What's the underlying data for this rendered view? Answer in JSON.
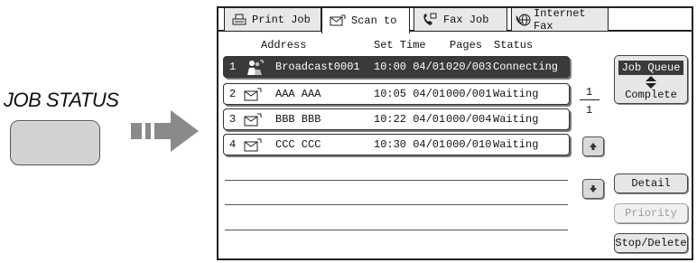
{
  "key_label": "JOB STATUS",
  "tabs": [
    {
      "label": "Print Job",
      "icon": "printer-icon"
    },
    {
      "label": "Scan to",
      "icon": "scan-envelope-icon"
    },
    {
      "label": "Fax Job",
      "icon": "fax-phone-icon"
    },
    {
      "label": "Internet Fax",
      "icon": "globe-phone-icon"
    }
  ],
  "active_tab": "Scan to",
  "columns": {
    "address": "Address",
    "set_time": "Set Time",
    "pages": "Pages",
    "status": "Status"
  },
  "jobs": [
    {
      "num": "1",
      "icon": "broadcast-icon",
      "address": "Broadcast0001",
      "time": "10:00 04/01",
      "pages": "020/003",
      "status": "Connecting",
      "selected": true
    },
    {
      "num": "2",
      "icon": "envelope-icon",
      "address": "AAA AAA",
      "time": "10:05 04/01",
      "pages": "000/001",
      "status": "Waiting",
      "selected": false
    },
    {
      "num": "3",
      "icon": "envelope-icon",
      "address": "BBB BBB",
      "time": "10:22 04/01",
      "pages": "000/004",
      "status": "Waiting",
      "selected": false
    },
    {
      "num": "4",
      "icon": "envelope-icon",
      "address": "CCC CCC",
      "time": "10:30 04/01",
      "pages": "000/010",
      "status": "Waiting",
      "selected": false
    }
  ],
  "page_indicator": {
    "current": "1",
    "total": "1"
  },
  "queue_toggle": {
    "top": "Job Queue",
    "bottom": "Complete",
    "selected": "Job Queue"
  },
  "buttons": {
    "detail": "Detail",
    "priority": "Priority",
    "stop_delete": "Stop/Delete"
  }
}
